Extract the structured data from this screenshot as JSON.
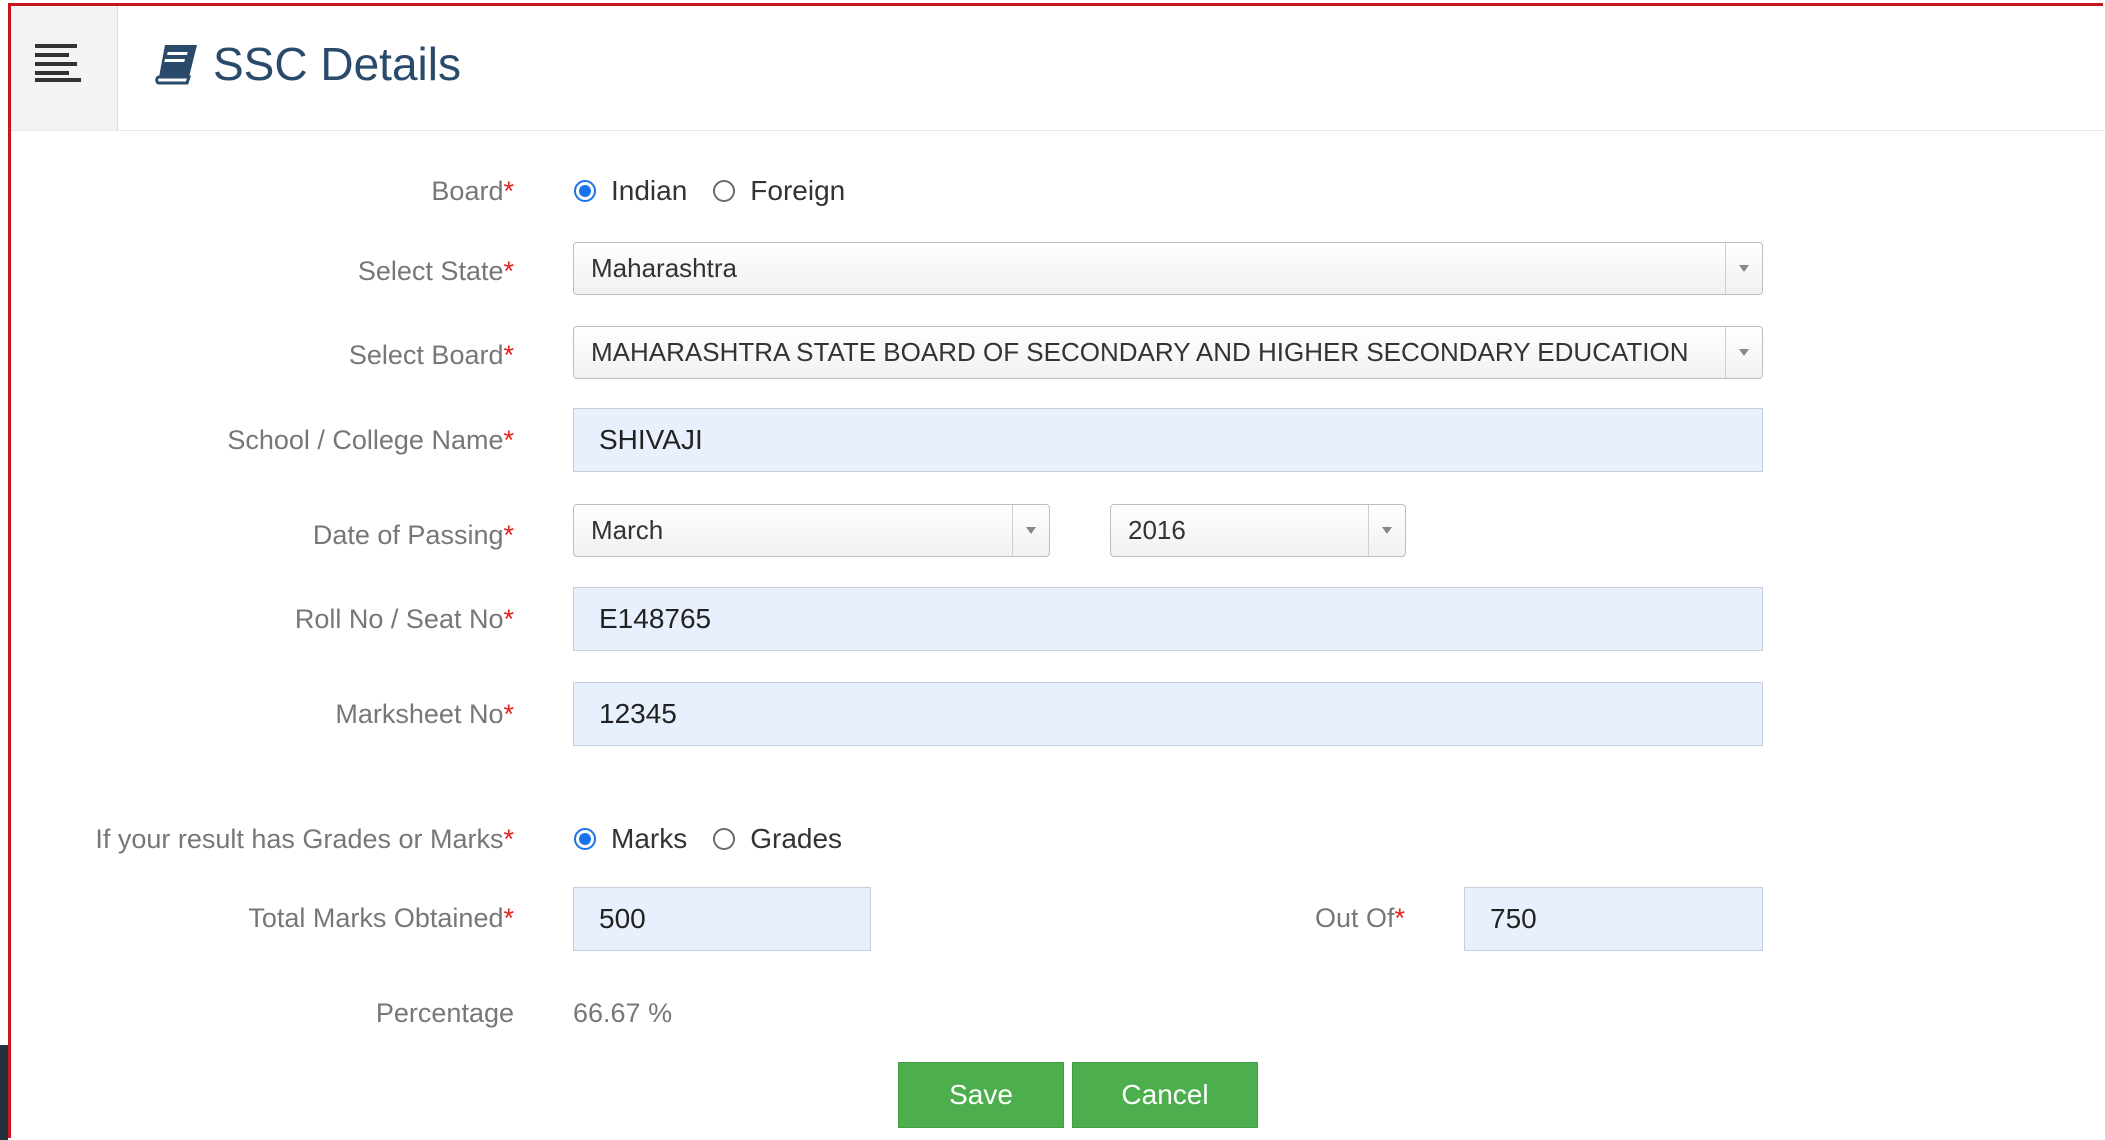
{
  "header": {
    "title": "SSC Details"
  },
  "icons": {
    "menu": "hamburger-menu-icon",
    "title": "book-icon"
  },
  "colors": {
    "primary_title": "#2a4a6b",
    "required": "#e2231a",
    "button": "#4cae4c",
    "radio_selected": "#1a73e8",
    "autofill_bg": "#e8f0fe"
  },
  "form": {
    "board": {
      "label": "Board",
      "required": "*",
      "options": [
        {
          "label": "Indian",
          "checked": true
        },
        {
          "label": "Foreign",
          "checked": false
        }
      ]
    },
    "state": {
      "label": "Select State",
      "required": "*",
      "value": "Maharashtra"
    },
    "select_board": {
      "label": "Select Board",
      "required": "*",
      "value": "MAHARASHTRA STATE BOARD OF SECONDARY AND HIGHER SECONDARY EDUCATION"
    },
    "school": {
      "label": "School / College Name",
      "required": "*",
      "value": "SHIVAJI"
    },
    "passing": {
      "label": "Date of Passing",
      "required": "*",
      "month": "March",
      "year": "2016"
    },
    "roll": {
      "label": "Roll No / Seat No",
      "required": "*",
      "value": "E148765"
    },
    "marksheet": {
      "label": "Marksheet No",
      "required": "*",
      "value": "12345"
    },
    "result_type": {
      "label": "If your result has Grades or Marks",
      "required": "*",
      "options": [
        {
          "label": "Marks",
          "checked": true
        },
        {
          "label": "Grades",
          "checked": false
        }
      ]
    },
    "total_marks": {
      "label": "Total Marks Obtained",
      "required": "*",
      "value": "500"
    },
    "out_of": {
      "label": "Out Of",
      "required": "*",
      "value": "750"
    },
    "percentage": {
      "label": "Percentage",
      "value": "66.67 %"
    }
  },
  "buttons": {
    "save": "Save",
    "cancel": "Cancel"
  }
}
